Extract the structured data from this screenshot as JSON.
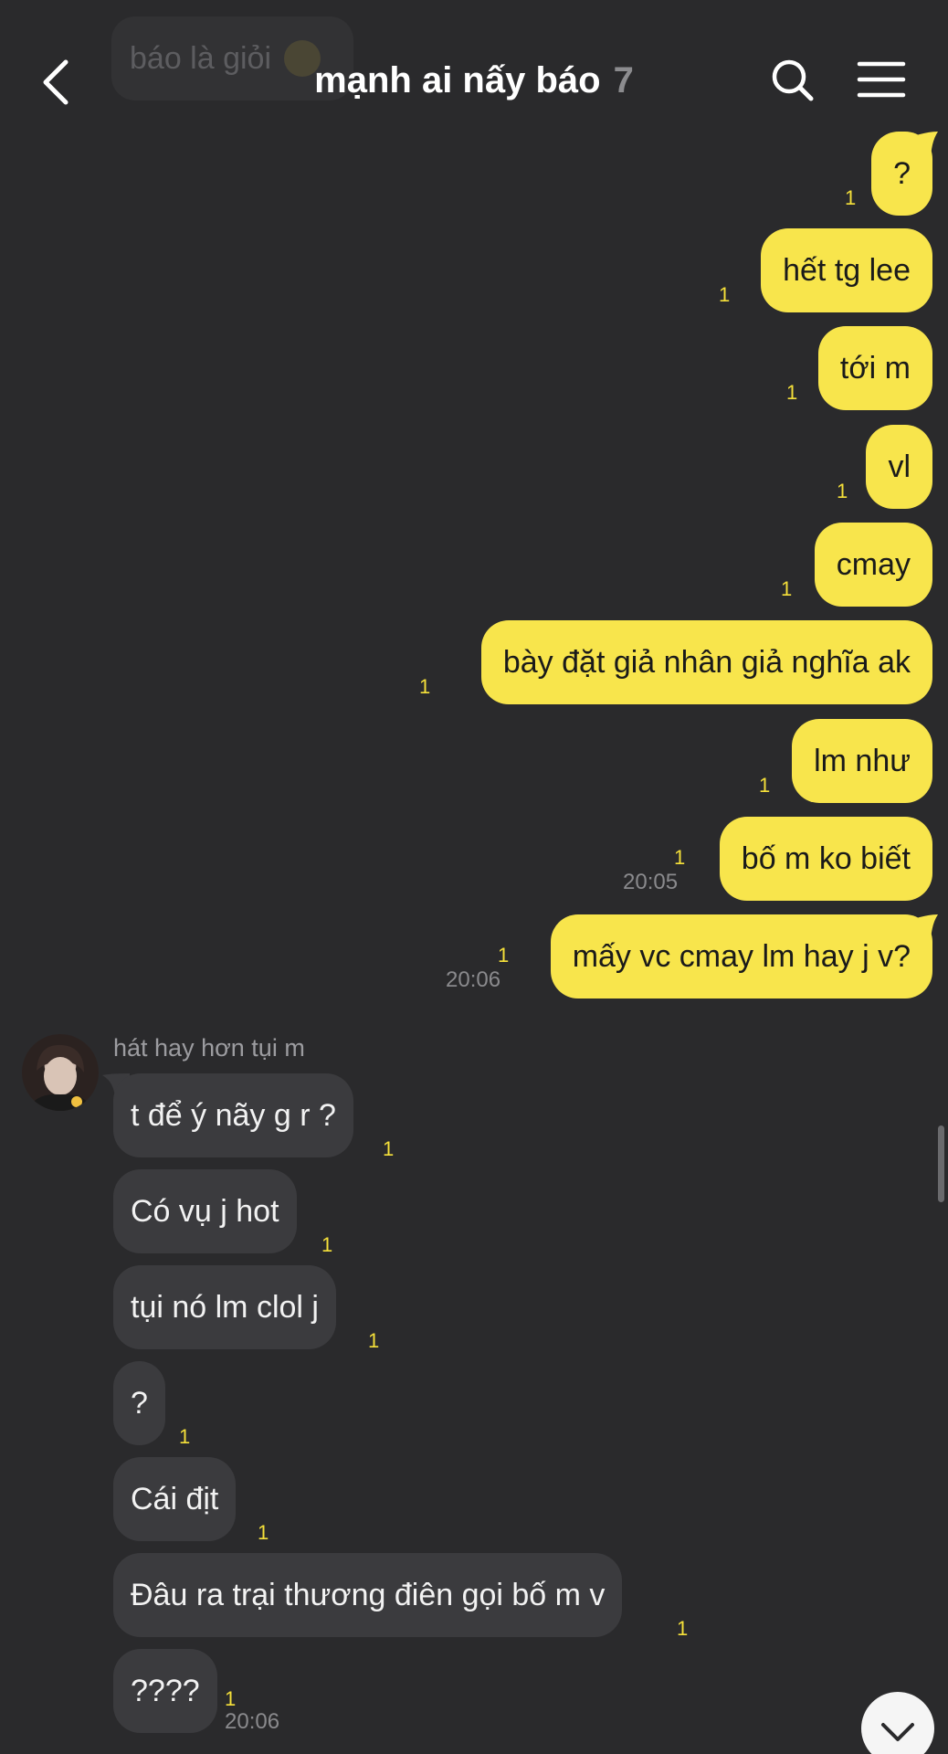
{
  "header": {
    "title": "mạnh ai nấy báo",
    "member_count": "7",
    "ghost_message": "báo là giỏi"
  },
  "icons": {
    "back": "chevron-left-icon",
    "search": "search-icon",
    "menu": "hamburger-menu-icon",
    "scroll_down": "chevron-down-icon"
  },
  "colors": {
    "background": "#2a2a2c",
    "my_bubble": "#f8e54c",
    "their_bubble": "#3b3b3e",
    "unread": "#f5e03a"
  },
  "my_messages": [
    {
      "text": "?",
      "unread": "1",
      "time": ""
    },
    {
      "text": "hết tg lee",
      "unread": "1",
      "time": ""
    },
    {
      "text": "tới m",
      "unread": "1",
      "time": ""
    },
    {
      "text": "vl",
      "unread": "1",
      "time": ""
    },
    {
      "text": "cmay",
      "unread": "1",
      "time": ""
    },
    {
      "text": "bày đặt giả nhân giả nghĩa ak",
      "unread": "1",
      "time": ""
    },
    {
      "text": "lm như",
      "unread": "1",
      "time": ""
    },
    {
      "text": "bố m ko biết",
      "unread": "1",
      "time": "20:05"
    },
    {
      "text": "mấy vc cmay lm hay j v?",
      "unread": "1",
      "time": "20:06"
    }
  ],
  "other_sender": {
    "name": "hát hay hơn tụi m",
    "messages": [
      {
        "text": "t để ý nãy g r ?",
        "unread": "1",
        "time": ""
      },
      {
        "text": "Có vụ j hot",
        "unread": "1",
        "time": ""
      },
      {
        "text": "tụi nó lm clol j",
        "unread": "1",
        "time": ""
      },
      {
        "text": "?",
        "unread": "1",
        "time": ""
      },
      {
        "text": "Cái địt",
        "unread": "1",
        "time": ""
      },
      {
        "text": "Đâu ra trại thương điên gọi bố m v",
        "unread": "1",
        "time": ""
      },
      {
        "text": "????",
        "unread": "1",
        "time": "20:06"
      }
    ]
  }
}
